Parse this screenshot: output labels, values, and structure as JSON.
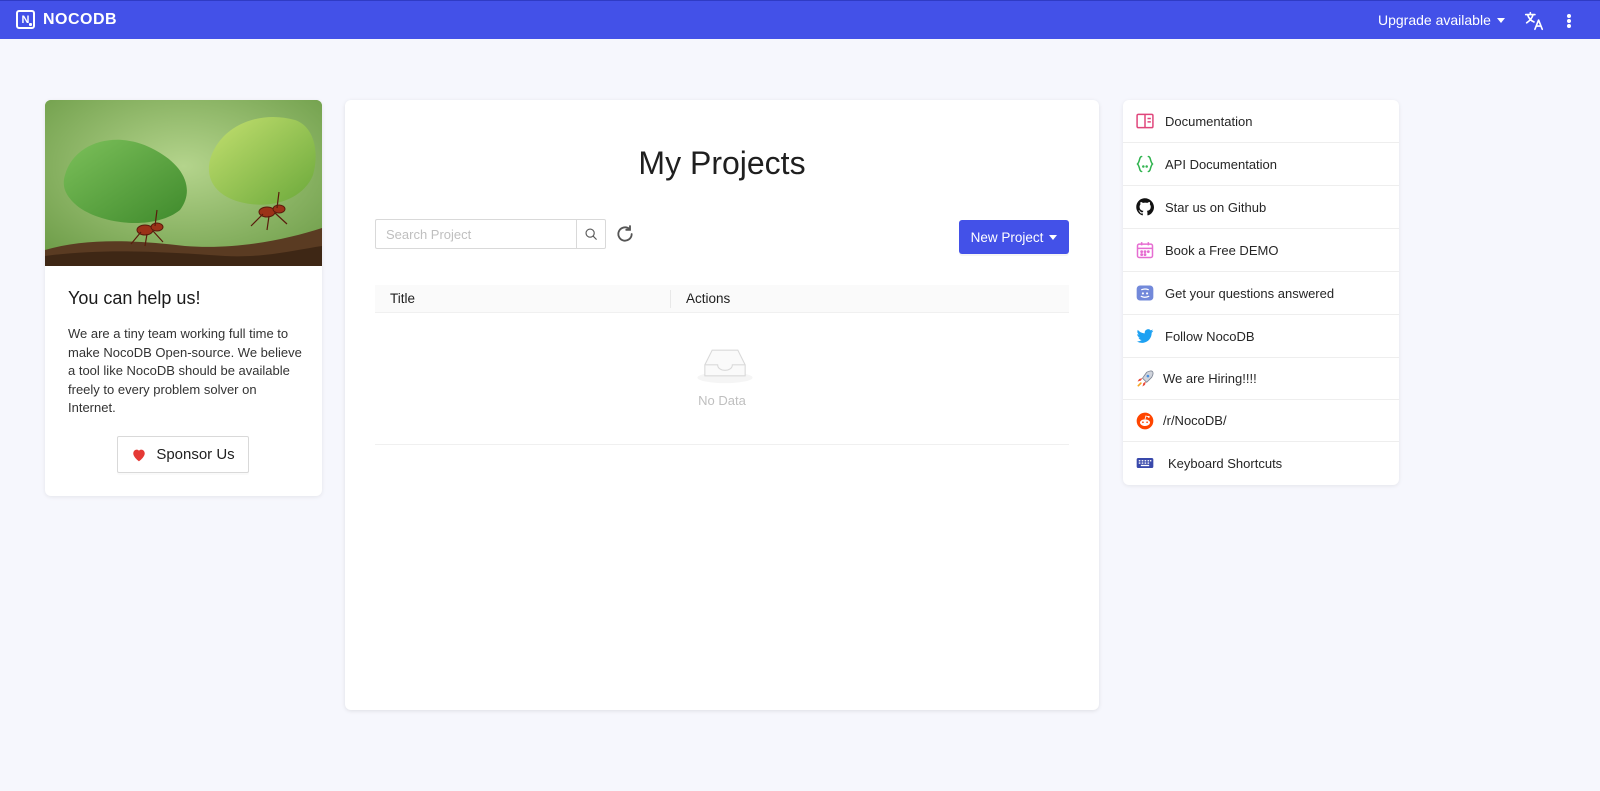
{
  "topbar": {
    "brand_letter": "N",
    "brand_name": "NOCODB",
    "upgrade_label": "Upgrade available"
  },
  "sponsor_card": {
    "title": "You can help us!",
    "text": "We are a tiny team working full time to make NocoDB Open-source. We believe a tool like NocoDB should be available freely to every problem solver on Internet.",
    "button_label": "Sponsor Us"
  },
  "projects": {
    "title": "My Projects",
    "search_placeholder": "Search Project",
    "new_project_label": "New Project",
    "columns": [
      "Title",
      "Actions"
    ],
    "empty_text": "No Data"
  },
  "links": {
    "items": [
      {
        "label": "Documentation",
        "icon": "book-icon"
      },
      {
        "label": "API Documentation",
        "icon": "braces-icon"
      },
      {
        "label": "Star us on Github",
        "icon": "github-icon"
      },
      {
        "label": "Book a Free DEMO",
        "icon": "calendar-icon"
      },
      {
        "label": "Get your questions answered",
        "icon": "discord-icon"
      },
      {
        "label": "Follow NocoDB",
        "icon": "twitter-icon"
      },
      {
        "label": "We are Hiring!!!!",
        "icon": "rocket-icon"
      },
      {
        "label": "/r/NocoDB/",
        "icon": "reddit-icon"
      },
      {
        "label": "Keyboard Shortcuts",
        "icon": "keyboard-icon"
      }
    ]
  },
  "colors": {
    "brand": "#4351e8",
    "background": "#f6f7fd",
    "heart": "#e53935"
  }
}
